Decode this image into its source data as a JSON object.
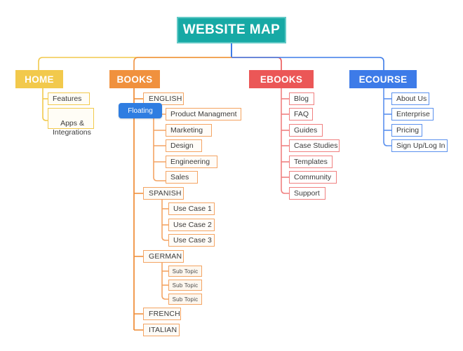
{
  "diagram": {
    "title": "WEBSITE MAP",
    "colors": {
      "root": "#17A9A5",
      "home": "#F2C94C",
      "books": "#F0913E",
      "ebooks": "#EB5757",
      "ecourse": "#3D7BE8",
      "floating": "#2F7DE1"
    }
  },
  "floating_note": {
    "label": "Floating"
  },
  "branches": {
    "home": {
      "label": "HOME",
      "children": [
        {
          "label": "Features"
        },
        {
          "label": "Apps &\nIntegrations"
        }
      ]
    },
    "books": {
      "label": "BOOKS",
      "groups": [
        {
          "label": "ENGLISH",
          "children": [
            {
              "label": "Product Managment"
            },
            {
              "label": "Marketing"
            },
            {
              "label": "Design"
            },
            {
              "label": "Engineering"
            },
            {
              "label": "Sales"
            }
          ]
        },
        {
          "label": "SPANISH",
          "children": [
            {
              "label": "Use Case 1"
            },
            {
              "label": "Use Case 2"
            },
            {
              "label": "Use Case 3"
            }
          ]
        },
        {
          "label": "GERMAN",
          "children": [
            {
              "label": "Sub Topic"
            },
            {
              "label": "Sub Topic"
            },
            {
              "label": "Sub Topic"
            }
          ]
        },
        {
          "label": "FRENCH",
          "children": []
        },
        {
          "label": "ITALIAN",
          "children": []
        }
      ]
    },
    "ebooks": {
      "label": "EBOOKS",
      "children": [
        {
          "label": "Blog"
        },
        {
          "label": "FAQ"
        },
        {
          "label": "Guides"
        },
        {
          "label": "Case Studies"
        },
        {
          "label": "Templates"
        },
        {
          "label": "Community"
        },
        {
          "label": "Support"
        }
      ]
    },
    "ecourse": {
      "label": "ECOURSE",
      "children": [
        {
          "label": "About Us"
        },
        {
          "label": "Enterprise"
        },
        {
          "label": "Pricing"
        },
        {
          "label": "Sign Up/Log In"
        }
      ]
    }
  }
}
